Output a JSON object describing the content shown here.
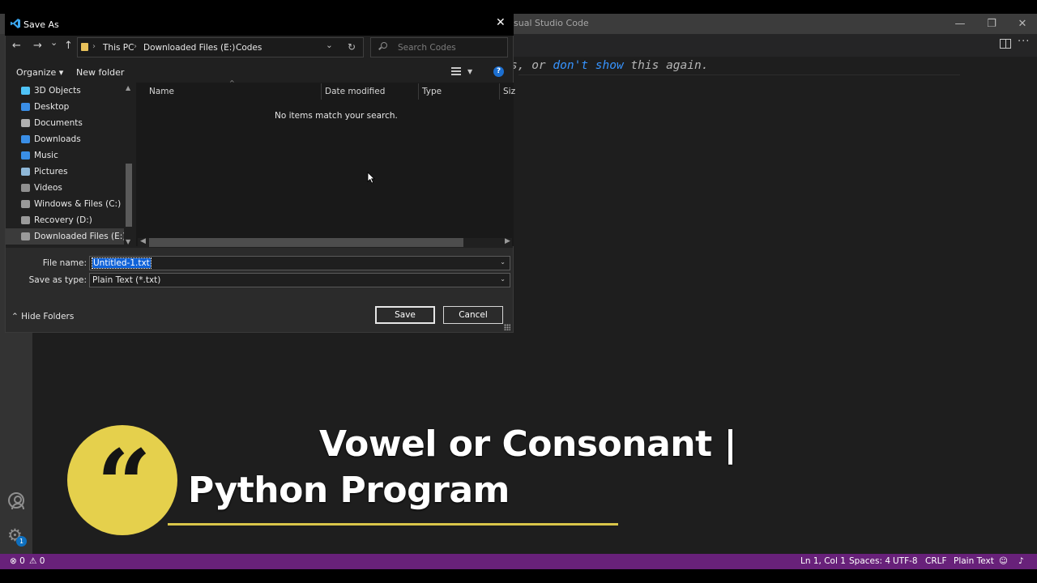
{
  "vscode": {
    "window_title": "sual Studio Code",
    "minimize": "—",
    "restore": "❐",
    "close": "✕",
    "more": "···",
    "hint": {
      "pre": "s, or ",
      "kw": "don't show",
      "post": " this again."
    },
    "manage_badge": "1"
  },
  "status_bar": {
    "errors": "⊗ 0",
    "warnings": "⚠ 0",
    "position": "Ln 1, Col 1",
    "spaces": "Spaces: 4",
    "encoding": "UTF-8",
    "eol": "CRLF",
    "language": "Plain Text",
    "feedback_icon": "feedback-icon",
    "bell_icon": "bell-icon",
    "bg_color": "#68217a"
  },
  "dialog": {
    "title": "Save As",
    "close": "✕",
    "back": "←",
    "forward": "→",
    "recent": "⌄",
    "up": "↑",
    "breadcrumb": [
      "This PC",
      "Downloaded Files (E:)",
      "Codes"
    ],
    "breadcrumb_sep": "›",
    "addr_dropdown": "⌄",
    "refresh": "↻",
    "search_placeholder": "Search Codes",
    "organize": "Organize ▾",
    "new_folder": "New folder",
    "view_dropdown": "▼",
    "help": "?",
    "nav_items": [
      {
        "label": "3D Objects",
        "icon": "cube-icon",
        "color": "#4fc3f7"
      },
      {
        "label": "Desktop",
        "icon": "desktop-icon",
        "color": "#3a8ee6"
      },
      {
        "label": "Documents",
        "icon": "documents-icon",
        "color": "#b0b0b0"
      },
      {
        "label": "Downloads",
        "icon": "download-icon",
        "color": "#3a8ee6"
      },
      {
        "label": "Music",
        "icon": "music-icon",
        "color": "#3a8ee6"
      },
      {
        "label": "Pictures",
        "icon": "pictures-icon",
        "color": "#8fb8d8"
      },
      {
        "label": "Videos",
        "icon": "videos-icon",
        "color": "#909090"
      },
      {
        "label": "Windows & Files (C:)",
        "icon": "drive-windows-icon",
        "color": "#9a9a9a"
      },
      {
        "label": "Recovery (D:)",
        "icon": "drive-icon",
        "color": "#9a9a9a"
      },
      {
        "label": "Downloaded Files (E:)",
        "icon": "drive-icon",
        "color": "#9a9a9a"
      }
    ],
    "columns": [
      "Name",
      "Date modified",
      "Type",
      "Siz"
    ],
    "sort_caret": "^",
    "empty_message": "No items match your search.",
    "file_name_label": "File name:",
    "file_name_value": "Untitled-1.txt",
    "save_as_type_label": "Save as type:",
    "save_as_type_value": "Plain Text (*.txt)",
    "combo_dropdown": "⌄",
    "hide_folders": "⌃ Hide Folders",
    "save": "Save",
    "cancel": "Cancel"
  },
  "overlay": {
    "quote": "“",
    "title_line1": "Vowel or Consonant |",
    "title_line2": "Python Program",
    "accent": "#e5d04c"
  }
}
